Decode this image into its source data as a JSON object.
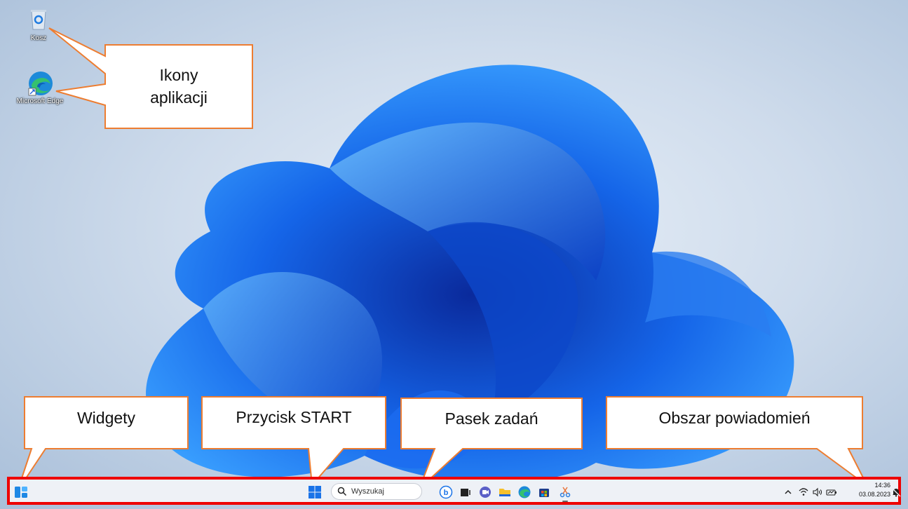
{
  "desktop": {
    "icons": [
      {
        "label": "Kosz",
        "icon": "recycle-bin-icon"
      },
      {
        "label": "Microsoft Edge",
        "icon": "edge-icon"
      }
    ]
  },
  "callouts": {
    "app_icons": "Ikony\naplikacji",
    "widgets": "Widgety",
    "start": "Przycisk START",
    "taskbar": "Pasek zadań",
    "notifications": "Obszar powiadomień"
  },
  "taskbar": {
    "search_placeholder": "Wyszukaj",
    "pinned": [
      "widgets-icon",
      "start-icon",
      "search-icon",
      "bing-chat-icon",
      "task-view-icon",
      "teams-chat-icon",
      "file-explorer-icon",
      "edge-icon",
      "store-icon",
      "snipping-tool-icon"
    ],
    "tray": {
      "time": "14:36",
      "date": "03.08.2023"
    }
  },
  "colors": {
    "callout_border": "#ed7d31",
    "taskbar_highlight": "#ee0000",
    "windows_blue": "#1a73e8"
  }
}
